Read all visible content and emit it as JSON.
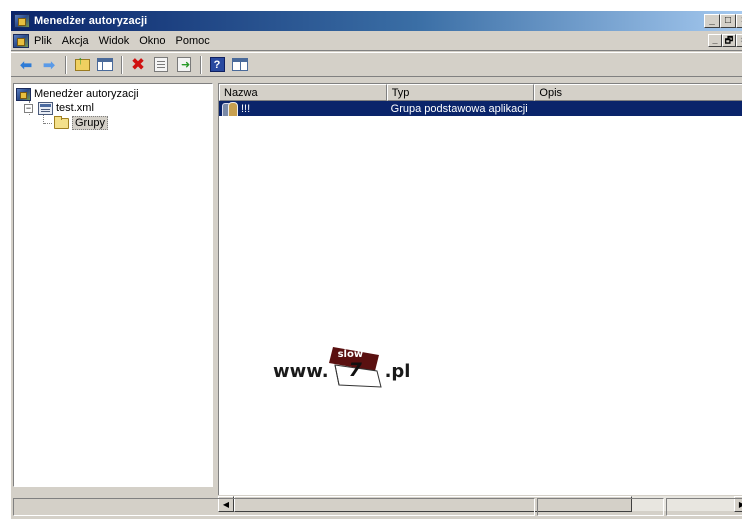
{
  "window": {
    "title": "Menedżer autoryzacji",
    "title_buttons": {
      "minimize": "_",
      "maximize": "□",
      "close": "×"
    }
  },
  "menubar": {
    "items": [
      "Plik",
      "Akcja",
      "Widok",
      "Okno",
      "Pomoc"
    ],
    "mdi_buttons": {
      "minimize": "_",
      "restore": "🗗",
      "close": "×"
    }
  },
  "toolbar": {
    "buttons": [
      "back-icon",
      "forward-icon",
      "up-one-level-icon",
      "show-hide-tree-icon",
      "delete-icon",
      "properties-icon",
      "export-list-icon",
      "help-icon",
      "mmc-view-icon"
    ]
  },
  "tree": {
    "root_label": "Menedżer autoryzacji",
    "store_label": "test.xml",
    "store_expander": "−",
    "groups_label": "Grupy"
  },
  "list": {
    "columns": [
      "Nazwa",
      "Typ",
      "Opis"
    ],
    "rows": [
      {
        "name": "!!!",
        "type": "Grupa podstawowa aplikacji",
        "description": ""
      }
    ]
  },
  "watermark": {
    "prefix": "www.",
    "tag": "slow",
    "number": "7",
    "suffix": ".pl"
  },
  "colors": {
    "titlebar_start": "#0a246a",
    "titlebar_end": "#a6caf0",
    "selection": "#0a246a",
    "chrome": "#d4d0c8"
  }
}
